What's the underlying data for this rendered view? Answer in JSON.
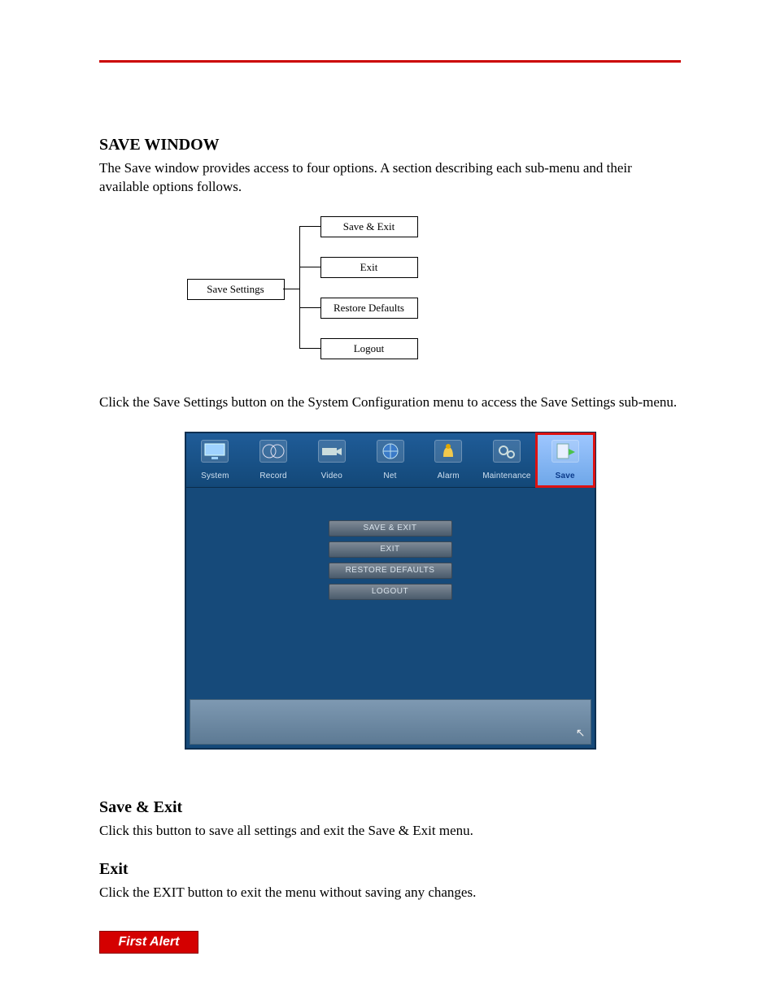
{
  "sections": {
    "save_window_heading": "SAVE WINDOW",
    "save_window_intro": "The Save window provides access to four options. A section describing each sub-menu and their available options follows.",
    "save_settings_instr": "Click the Save Settings button on the System Configuration menu to access the Save Settings sub-menu.",
    "save_exit_heading": "Save & Exit",
    "save_exit_body": "Click this button to save all settings and exit the Save & Exit menu.",
    "exit_heading": "Exit",
    "exit_body": "Click the EXIT button to exit the menu without saving any changes."
  },
  "tree": {
    "root": "Save Settings",
    "leaves": [
      "Save & Exit",
      "Exit",
      "Restore Defaults",
      "Logout"
    ]
  },
  "dvr": {
    "tabs": [
      {
        "label": "System",
        "icon": "monitor-icon"
      },
      {
        "label": "Record",
        "icon": "film-reel-icon"
      },
      {
        "label": "Video",
        "icon": "camera-icon"
      },
      {
        "label": "Net",
        "icon": "globe-icon"
      },
      {
        "label": "Alarm",
        "icon": "bell-icon"
      },
      {
        "label": "Maintenance",
        "icon": "gears-icon"
      },
      {
        "label": "Save",
        "icon": "save-arrow-icon",
        "selected": true
      }
    ],
    "buttons": [
      "SAVE & EXIT",
      "EXIT",
      "RESTORE DEFAULTS",
      "LOGOUT"
    ]
  },
  "footer": {
    "brand": "First Alert"
  }
}
